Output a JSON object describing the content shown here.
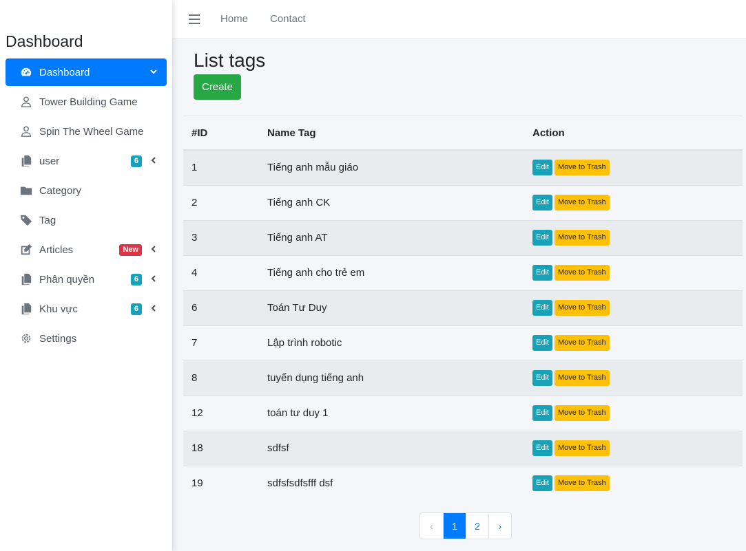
{
  "sidebar": {
    "brand": "Dashboard",
    "items": [
      {
        "label": "Dashboard",
        "icon": "tachometer-icon",
        "active": true
      },
      {
        "label": "Tower Building Game",
        "icon": "user-icon"
      },
      {
        "label": "Spin The Wheel Game",
        "icon": "user-icon"
      },
      {
        "label": "user",
        "icon": "copy-icon",
        "badge": "6"
      },
      {
        "label": "Category",
        "icon": "folder-icon"
      },
      {
        "label": "Tag",
        "icon": "tag-icon"
      },
      {
        "label": "Articles",
        "icon": "edit-icon",
        "badge": "New"
      },
      {
        "label": "Phân quyền",
        "icon": "copy-icon",
        "badge": "6"
      },
      {
        "label": "Khu vực",
        "icon": "copy-icon",
        "badge": "6"
      },
      {
        "label": "Settings",
        "icon": "gear-icon"
      }
    ]
  },
  "topnav": {
    "home": "Home",
    "contact": "Contact"
  },
  "main": {
    "title": "List tags",
    "create_label": "Create",
    "columns": [
      "#ID",
      "Name Tag",
      "Action"
    ],
    "edit_label": "Edit",
    "trash_label": "Move to Trash",
    "rows": [
      {
        "id": "1",
        "name": "Tiếng anh mẫu giáo"
      },
      {
        "id": "2",
        "name": "Tiếng anh CK"
      },
      {
        "id": "3",
        "name": "Tiếng anh AT"
      },
      {
        "id": "4",
        "name": "Tiếng anh cho trẻ em"
      },
      {
        "id": "6",
        "name": "Toán Tư Duy"
      },
      {
        "id": "7",
        "name": "Lập trình robotic"
      },
      {
        "id": "8",
        "name": "tuyển dụng tiếng anh"
      },
      {
        "id": "12",
        "name": "toán tư duy 1"
      },
      {
        "id": "18",
        "name": "sdfsf"
      },
      {
        "id": "19",
        "name": "sdfsfsdfsfff dsf"
      }
    ]
  },
  "pagination": {
    "prev": "‹",
    "pages": [
      "1",
      "2"
    ],
    "next": "›",
    "current": "1"
  },
  "colors": {
    "primary": "#007bff",
    "success": "#28a745",
    "info": "#17a2b8",
    "warning": "#ffc107",
    "danger": "#dc3545"
  }
}
